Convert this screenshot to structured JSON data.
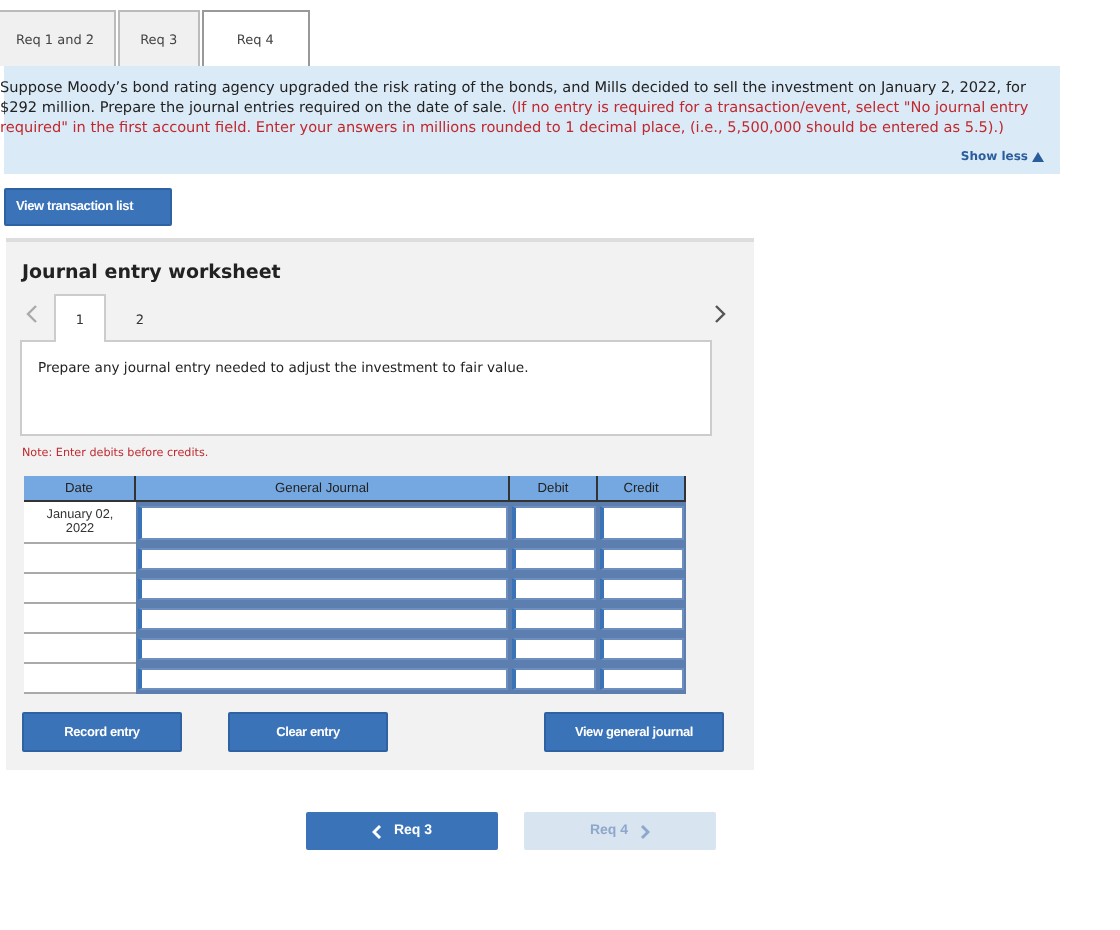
{
  "req_tabs": [
    {
      "label": "Req 1 and 2",
      "selected": false
    },
    {
      "label": "Req 3",
      "selected": false
    },
    {
      "label": "Req 4",
      "selected": true
    }
  ],
  "question": {
    "text": "Suppose Moody’s bond rating agency upgraded the risk rating of the bonds, and Mills decided to sell the investment on January 2, 2022, for $292 million. Prepare the journal entries required on the date of sale.",
    "instruction": "(If no entry is required for a transaction/event, select \"No journal entry required\" in the first account field. Enter your answers in millions rounded to 1 decimal place, (i.e., 5,500,000 should be entered as 5.5).)",
    "toggle": "Show less"
  },
  "view_transaction_button": "View transaction list",
  "worksheet": {
    "title": "Journal entry worksheet",
    "prev_disabled": true,
    "next_disabled": false,
    "entry_tabs": [
      {
        "label": "1",
        "selected": true
      },
      {
        "label": "2",
        "selected": false
      }
    ],
    "prompt": "Prepare any journal entry needed to adjust the investment to fair value.",
    "note": "Note: Enter debits before credits.",
    "columns": [
      "Date",
      "General Journal",
      "Debit",
      "Credit"
    ],
    "rows": [
      {
        "date": "January 02, 2022"
      },
      {},
      {},
      {},
      {},
      {}
    ],
    "buttons": [
      "Record entry",
      "Clear entry",
      "View general journal"
    ]
  },
  "nav": [
    {
      "label": "Req 3",
      "kind": "prev",
      "disabled": false
    },
    {
      "label": "Req 4",
      "kind": "next",
      "disabled": true
    }
  ]
}
